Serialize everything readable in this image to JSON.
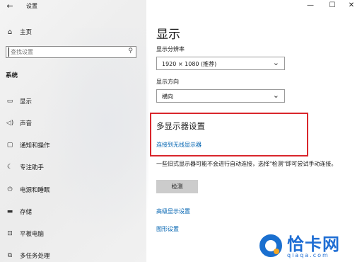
{
  "window": {
    "title": "设置",
    "back_icon": "←",
    "minimize_icon": "—",
    "maximize_icon": "☐",
    "close_icon": "✕"
  },
  "sidebar": {
    "home": {
      "icon": "⌂",
      "label": "主页"
    },
    "search": {
      "placeholder": "查找设置",
      "icon": "⚲"
    },
    "group": "系统",
    "items": [
      {
        "icon": "▭",
        "label": "显示"
      },
      {
        "icon": "◁)",
        "label": "声音"
      },
      {
        "icon": "▢",
        "label": "通知和操作"
      },
      {
        "icon": "☾",
        "label": "专注助手"
      },
      {
        "icon": "⏻",
        "label": "电源和睡眠"
      },
      {
        "icon": "▬",
        "label": "存储"
      },
      {
        "icon": "⊡",
        "label": "平板电脑"
      },
      {
        "icon": "⧉",
        "label": "多任务处理"
      }
    ]
  },
  "main": {
    "title": "显示",
    "resolution": {
      "label": "显示分辨率",
      "value": "1920 × 1080 (推荐)"
    },
    "orientation": {
      "label": "显示方向",
      "value": "横向"
    },
    "multi_display": {
      "title": "多显示器设置",
      "connect_link": "连接到无线显示器"
    },
    "info": "一些旧式显示器可能不会进行自动连接，选择\"检测\"即可尝试手动连接。",
    "detect_button": "检测",
    "advanced_link": "高级显示设置",
    "graphics_link": "图形设置"
  },
  "watermark": {
    "title": "恰卡网",
    "subtitle": "qiaqa.com"
  },
  "colors": {
    "accent": "#0063b1",
    "highlight": "#d9262c",
    "watermark": "#1f6ed4"
  }
}
